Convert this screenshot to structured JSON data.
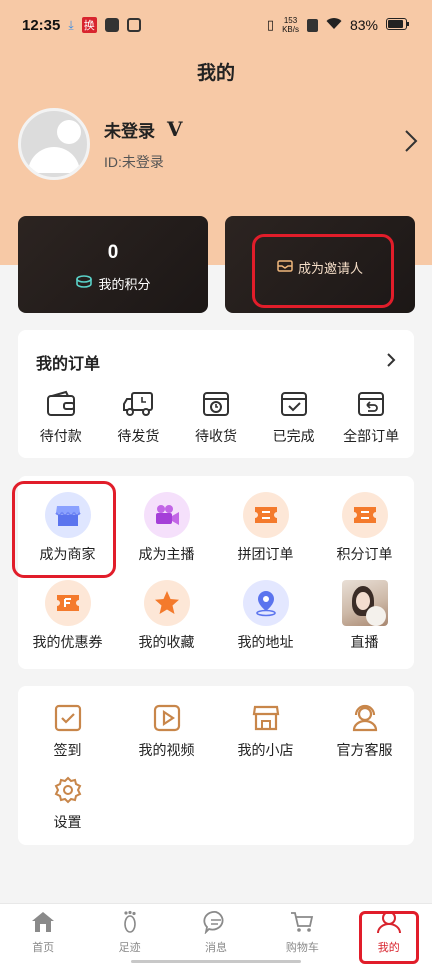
{
  "status_bar": {
    "time": "12:35",
    "speed_value": "153",
    "speed_unit": "KB/s",
    "battery": "83%",
    "app_badge": "换"
  },
  "header": {
    "title": "我的"
  },
  "profile": {
    "name": "未登录",
    "vip": "V",
    "id_text": "ID:未登录"
  },
  "cards": {
    "points_value": "0",
    "points_label": "我的积分",
    "invite_label": "成为邀请人"
  },
  "orders": {
    "title": "我的订单",
    "items": [
      {
        "label": "待付款",
        "icon": "wallet-icon"
      },
      {
        "label": "待发货",
        "icon": "truck-icon"
      },
      {
        "label": "待收货",
        "icon": "package-clock-icon"
      },
      {
        "label": "已完成",
        "icon": "check-box-icon"
      },
      {
        "label": "全部订单",
        "icon": "return-box-icon"
      }
    ]
  },
  "services": {
    "items": [
      {
        "label": "成为商家",
        "icon": "store-icon"
      },
      {
        "label": "成为主播",
        "icon": "video-camera-icon"
      },
      {
        "label": "拼团订单",
        "icon": "ticket-icon"
      },
      {
        "label": "积分订单",
        "icon": "ticket-icon"
      },
      {
        "label": "我的优惠券",
        "icon": "coupon-icon"
      },
      {
        "label": "我的收藏",
        "icon": "star-icon"
      },
      {
        "label": "我的地址",
        "icon": "location-icon"
      },
      {
        "label": "直播",
        "icon": "live-thumbnail"
      }
    ]
  },
  "tools": {
    "items": [
      {
        "label": "签到",
        "icon": "checkin-icon"
      },
      {
        "label": "我的视频",
        "icon": "play-icon"
      },
      {
        "label": "我的小店",
        "icon": "shop-icon"
      },
      {
        "label": "官方客服",
        "icon": "headset-icon"
      },
      {
        "label": "设置",
        "icon": "gear-icon"
      }
    ]
  },
  "tabbar": {
    "items": [
      {
        "label": "首页",
        "icon": "home-icon"
      },
      {
        "label": "足迹",
        "icon": "footprint-icon"
      },
      {
        "label": "消息",
        "icon": "message-icon"
      },
      {
        "label": "购物车",
        "icon": "cart-icon"
      },
      {
        "label": "我的",
        "icon": "person-icon"
      }
    ],
    "active_index": 4
  },
  "colors": {
    "header_bg": "#f7c9a6",
    "accent_red": "#d8242e",
    "tool_icon": "#c8864a",
    "card_dark": "#241d1b"
  }
}
